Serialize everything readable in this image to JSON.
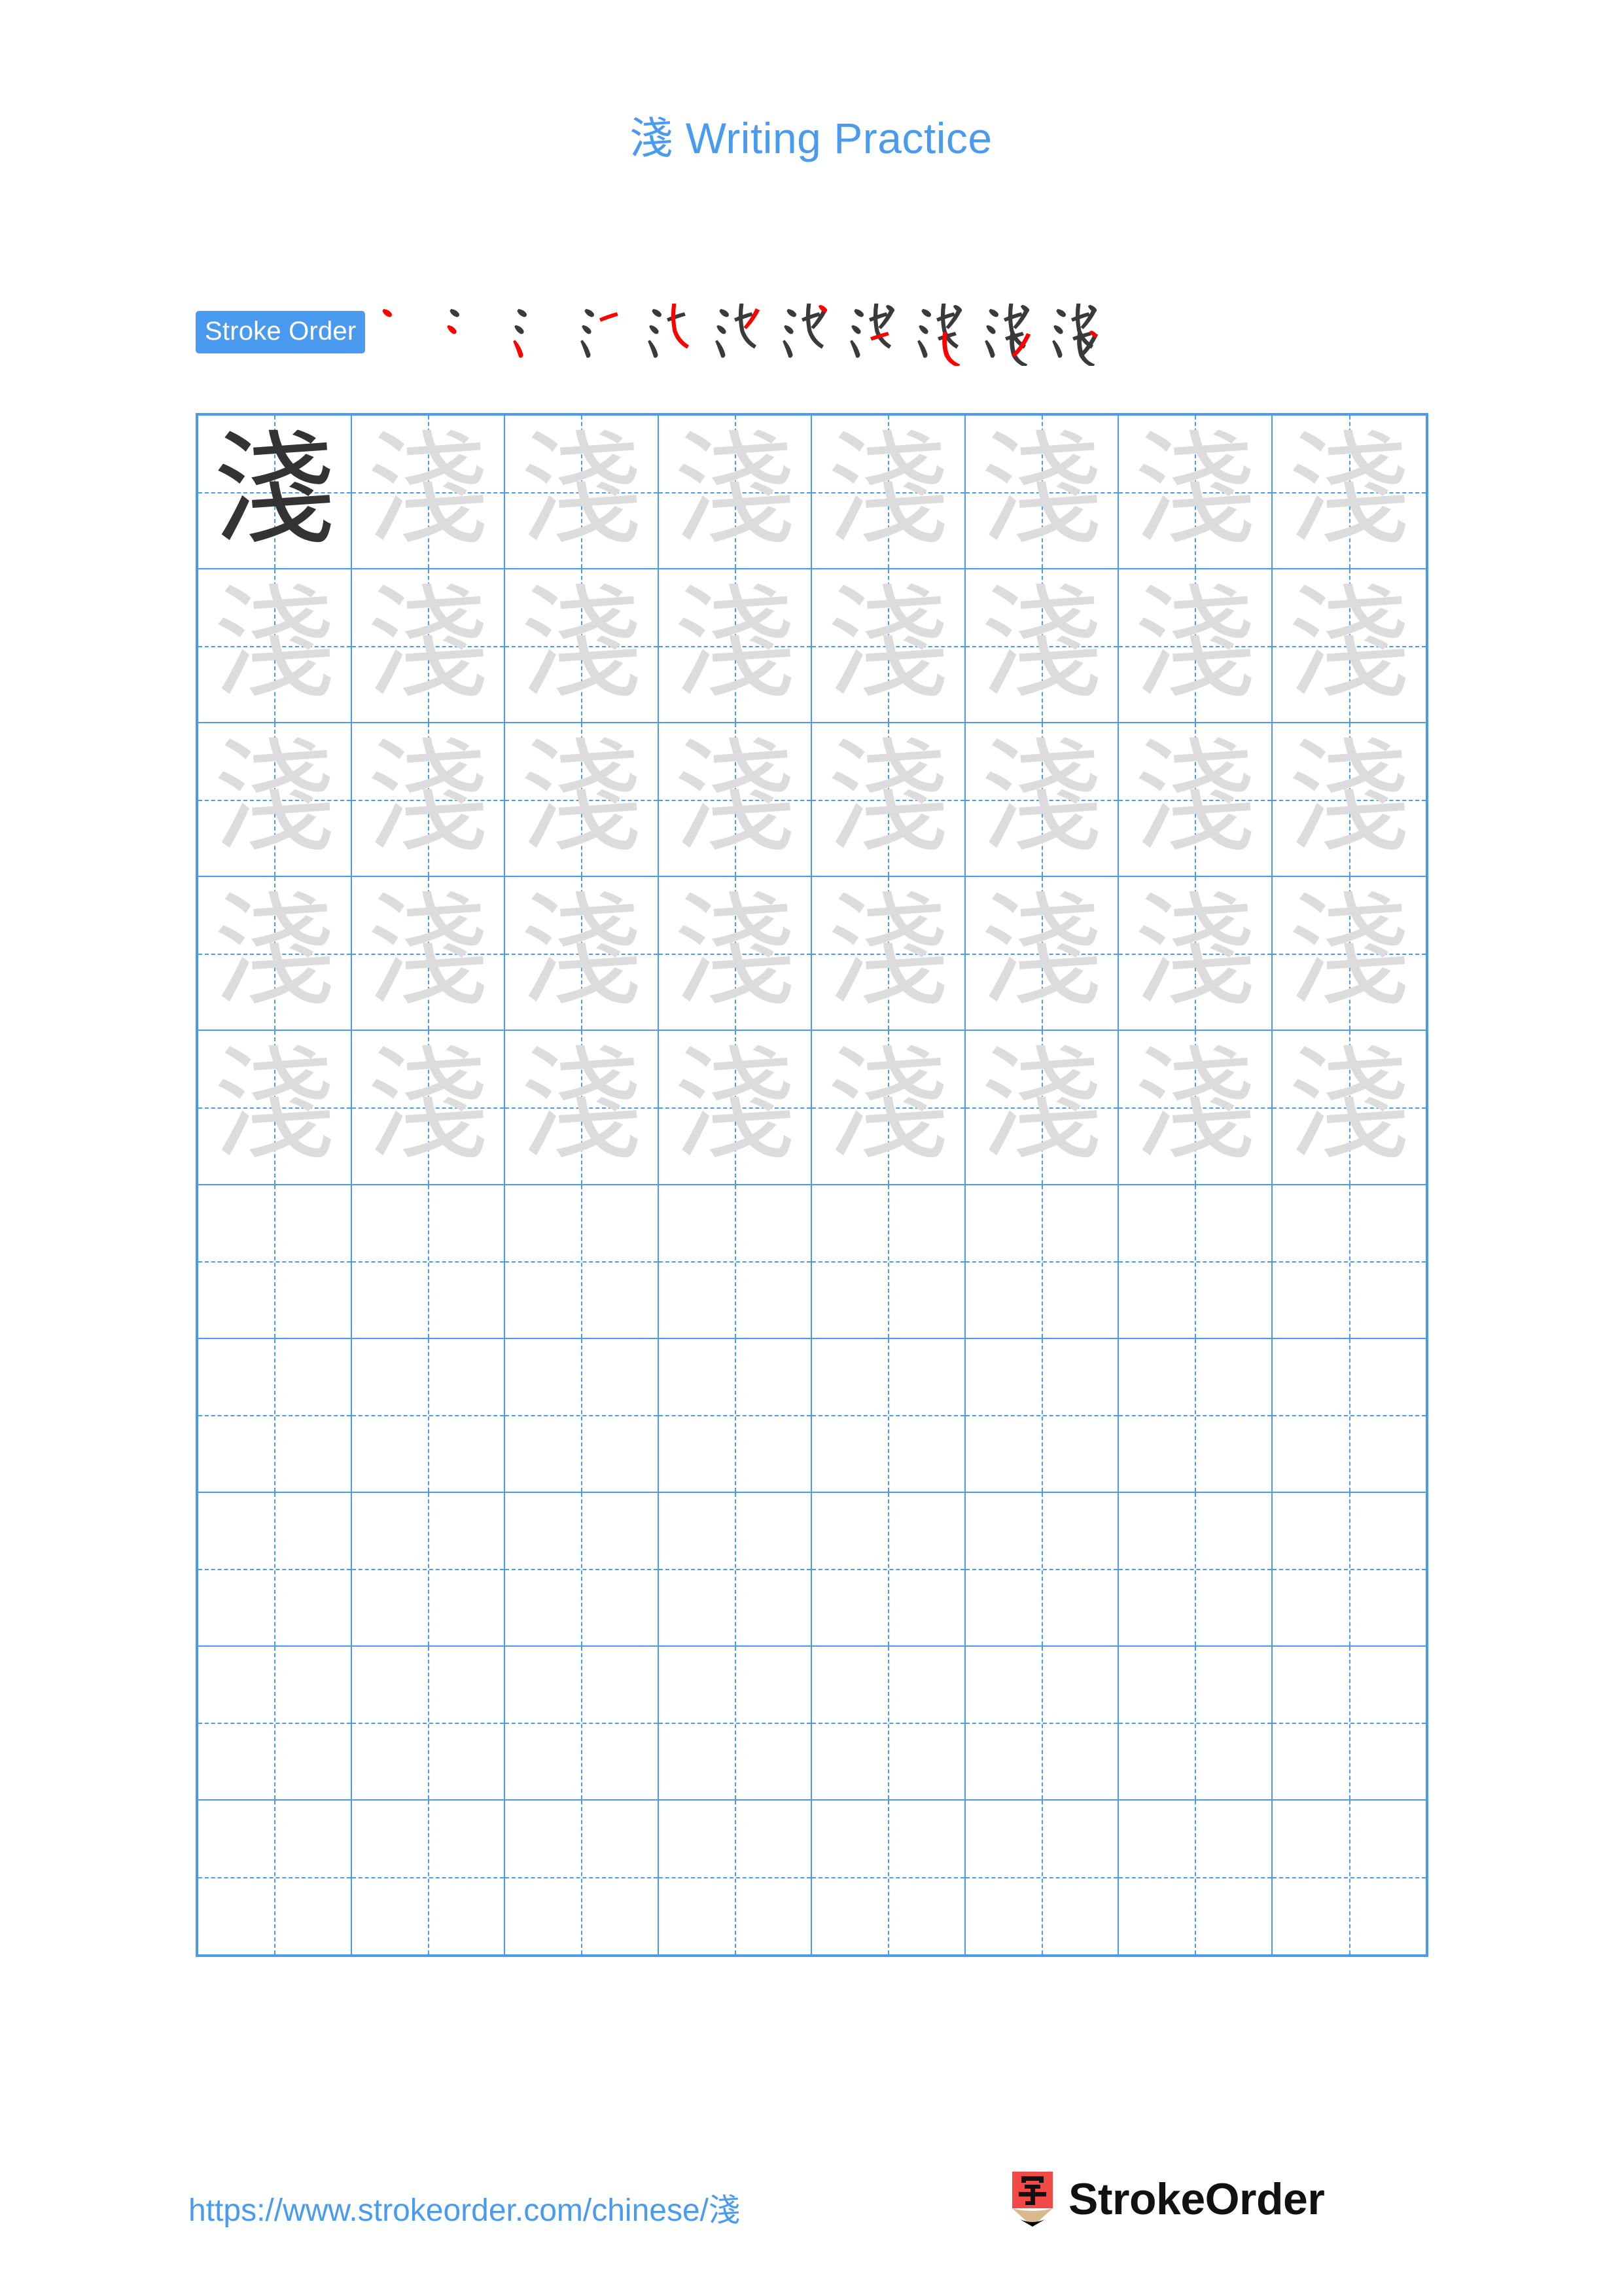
{
  "page": {
    "character": "淺",
    "title_prefix": "淺",
    "title_text": " Writing Practice",
    "accent_color": "#4a9bf0",
    "trace_gray": "#dcdcdc",
    "ink_dark": "#333333",
    "stroke_new_color": "#ff0000",
    "stroke_done_color": "#3a3a3a"
  },
  "stroke_order": {
    "label": "Stroke Order",
    "total_strokes": 11,
    "steps": [
      1,
      2,
      3,
      4,
      5,
      6,
      7,
      8,
      9,
      10,
      11
    ]
  },
  "grid": {
    "columns": 8,
    "rows": 10,
    "cells": [
      {
        "glyph": "淺",
        "style": "dark"
      },
      {
        "glyph": "淺",
        "style": "light"
      },
      {
        "glyph": "淺",
        "style": "light"
      },
      {
        "glyph": "淺",
        "style": "light"
      },
      {
        "glyph": "淺",
        "style": "light"
      },
      {
        "glyph": "淺",
        "style": "light"
      },
      {
        "glyph": "淺",
        "style": "light"
      },
      {
        "glyph": "淺",
        "style": "light"
      },
      {
        "glyph": "淺",
        "style": "light"
      },
      {
        "glyph": "淺",
        "style": "light"
      },
      {
        "glyph": "淺",
        "style": "light"
      },
      {
        "glyph": "淺",
        "style": "light"
      },
      {
        "glyph": "淺",
        "style": "light"
      },
      {
        "glyph": "淺",
        "style": "light"
      },
      {
        "glyph": "淺",
        "style": "light"
      },
      {
        "glyph": "淺",
        "style": "light"
      },
      {
        "glyph": "淺",
        "style": "light"
      },
      {
        "glyph": "淺",
        "style": "light"
      },
      {
        "glyph": "淺",
        "style": "light"
      },
      {
        "glyph": "淺",
        "style": "light"
      },
      {
        "glyph": "淺",
        "style": "light"
      },
      {
        "glyph": "淺",
        "style": "light"
      },
      {
        "glyph": "淺",
        "style": "light"
      },
      {
        "glyph": "淺",
        "style": "light"
      },
      {
        "glyph": "淺",
        "style": "light"
      },
      {
        "glyph": "淺",
        "style": "light"
      },
      {
        "glyph": "淺",
        "style": "light"
      },
      {
        "glyph": "淺",
        "style": "light"
      },
      {
        "glyph": "淺",
        "style": "light"
      },
      {
        "glyph": "淺",
        "style": "light"
      },
      {
        "glyph": "淺",
        "style": "light"
      },
      {
        "glyph": "淺",
        "style": "light"
      },
      {
        "glyph": "淺",
        "style": "light"
      },
      {
        "glyph": "淺",
        "style": "light"
      },
      {
        "glyph": "淺",
        "style": "light"
      },
      {
        "glyph": "淺",
        "style": "light"
      },
      {
        "glyph": "淺",
        "style": "light"
      },
      {
        "glyph": "淺",
        "style": "light"
      },
      {
        "glyph": "淺",
        "style": "light"
      },
      {
        "glyph": "淺",
        "style": "light"
      },
      {
        "glyph": "",
        "style": "empty"
      },
      {
        "glyph": "",
        "style": "empty"
      },
      {
        "glyph": "",
        "style": "empty"
      },
      {
        "glyph": "",
        "style": "empty"
      },
      {
        "glyph": "",
        "style": "empty"
      },
      {
        "glyph": "",
        "style": "empty"
      },
      {
        "glyph": "",
        "style": "empty"
      },
      {
        "glyph": "",
        "style": "empty"
      },
      {
        "glyph": "",
        "style": "empty"
      },
      {
        "glyph": "",
        "style": "empty"
      },
      {
        "glyph": "",
        "style": "empty"
      },
      {
        "glyph": "",
        "style": "empty"
      },
      {
        "glyph": "",
        "style": "empty"
      },
      {
        "glyph": "",
        "style": "empty"
      },
      {
        "glyph": "",
        "style": "empty"
      },
      {
        "glyph": "",
        "style": "empty"
      },
      {
        "glyph": "",
        "style": "empty"
      },
      {
        "glyph": "",
        "style": "empty"
      },
      {
        "glyph": "",
        "style": "empty"
      },
      {
        "glyph": "",
        "style": "empty"
      },
      {
        "glyph": "",
        "style": "empty"
      },
      {
        "glyph": "",
        "style": "empty"
      },
      {
        "glyph": "",
        "style": "empty"
      },
      {
        "glyph": "",
        "style": "empty"
      },
      {
        "glyph": "",
        "style": "empty"
      },
      {
        "glyph": "",
        "style": "empty"
      },
      {
        "glyph": "",
        "style": "empty"
      },
      {
        "glyph": "",
        "style": "empty"
      },
      {
        "glyph": "",
        "style": "empty"
      },
      {
        "glyph": "",
        "style": "empty"
      },
      {
        "glyph": "",
        "style": "empty"
      },
      {
        "glyph": "",
        "style": "empty"
      },
      {
        "glyph": "",
        "style": "empty"
      },
      {
        "glyph": "",
        "style": "empty"
      },
      {
        "glyph": "",
        "style": "empty"
      },
      {
        "glyph": "",
        "style": "empty"
      },
      {
        "glyph": "",
        "style": "empty"
      },
      {
        "glyph": "",
        "style": "empty"
      },
      {
        "glyph": "",
        "style": "empty"
      },
      {
        "glyph": "",
        "style": "empty"
      }
    ]
  },
  "footer": {
    "url_prefix": "https://www.strokeorder.com/chinese/",
    "url_character": "淺",
    "brand_name": "StrokeOrder",
    "brand_mark_character": "字",
    "brand_mark_color": "#ef4a45",
    "brand_mark_wood_color": "#d9b98c"
  }
}
